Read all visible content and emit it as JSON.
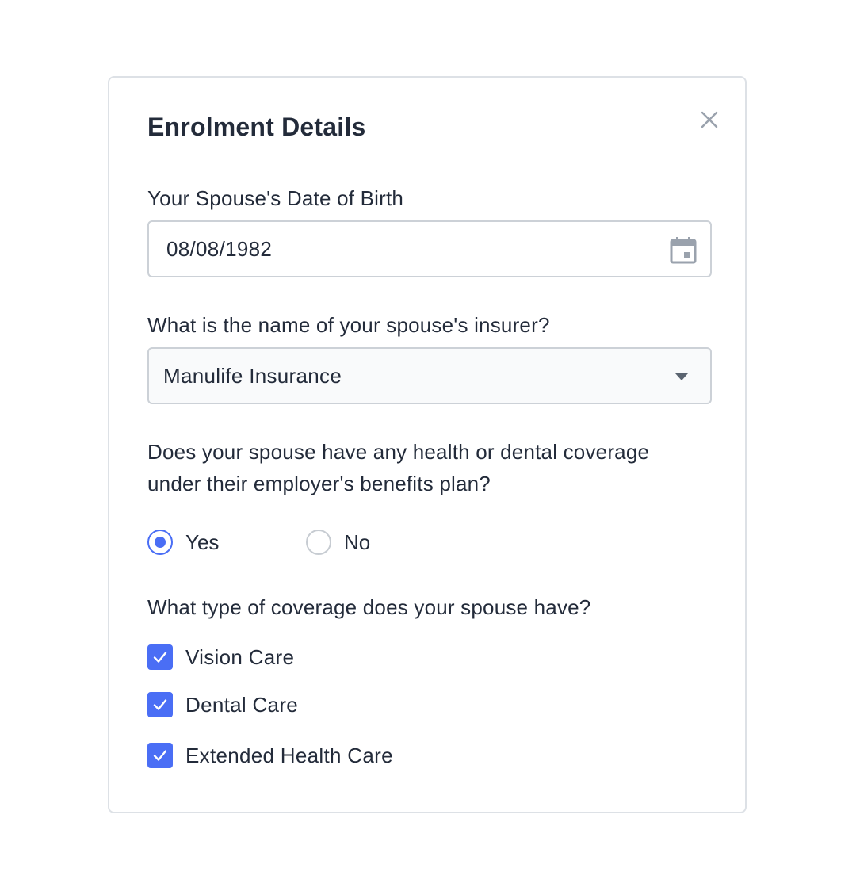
{
  "dialog": {
    "title": "Enrolment Details",
    "close_icon": "close-icon"
  },
  "spouse_dob": {
    "label": "Your Spouse's Date of Birth",
    "value": "08/08/1982",
    "icon": "calendar-icon"
  },
  "insurer": {
    "label": "What is the name of your spouse's insurer?",
    "selected": "Manulife Insurance",
    "icon": "caret-down-icon"
  },
  "employer_coverage": {
    "question_line1": "Does your spouse have any health or dental coverage",
    "question_line2": "under their employer's benefits plan?",
    "options": [
      {
        "label": "Yes",
        "selected": true
      },
      {
        "label": "No",
        "selected": false
      }
    ]
  },
  "coverage_type": {
    "label": "What type of coverage does your spouse have?",
    "options": [
      {
        "label": "Vision Care",
        "checked": true
      },
      {
        "label": "Dental Care",
        "checked": true
      },
      {
        "label": "Extended Health Care",
        "checked": true
      }
    ]
  },
  "colors": {
    "accent": "#4a6ef5",
    "text": "#232b3a",
    "border": "#ccd1d7",
    "icon_gray": "#9aa2ad"
  }
}
